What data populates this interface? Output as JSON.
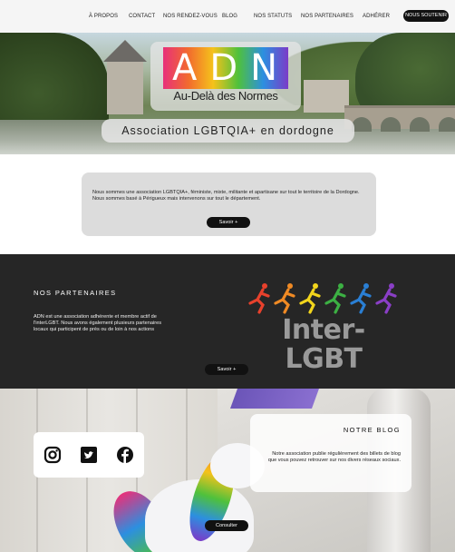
{
  "nav": {
    "items": [
      "À PROPOS",
      "CONTACT",
      "NOS RENDEZ-VOUS",
      "BLOG",
      "NOS STATUTS",
      "NOS PARTENAIRES",
      "ADHÉRER"
    ],
    "support_label": "NOUS SOUTENIR"
  },
  "hero": {
    "logo_letters": "ADN",
    "logo_subtitle": "Au-Delà des Normes",
    "tagline": "Association LGBTQIA+ en dordogne"
  },
  "intro": {
    "text": "Nous sommes une association LGBTQIA+, féministe, mixte, militante et apartisane sur tout le territoire de la Dordogne. Nous sommes basé à Périgueux mais intervenons sur tout le département.",
    "button_label": "Savoir +"
  },
  "partners": {
    "heading": "NOS PARTENAIRES",
    "text": "ADN est une association adhérente et membre actif de l'interLGBT. Nous avons également plusieurs partenaires locaux qui participent de près ou de loin à nos actions",
    "logo_text": "Inter-LGBT",
    "button_label": "Savoir +"
  },
  "blog": {
    "heading": "NOTRE BLOG",
    "text": "Notre association publie régulièrement des billets de blog que vous pouvez retrouver sur nos divers réseaux sociaux.",
    "button_label": "Consulter",
    "social_icons": [
      "instagram-icon",
      "twitter-icon",
      "facebook-icon"
    ]
  },
  "colors": {
    "dark_section": "#262626",
    "button_bg": "#111111",
    "card_gray": "#dcdcdc",
    "rainbow": [
      "#e8307a",
      "#f26a2e",
      "#f5c21b",
      "#4fc13c",
      "#2c8fe0",
      "#7b3bc8"
    ]
  }
}
